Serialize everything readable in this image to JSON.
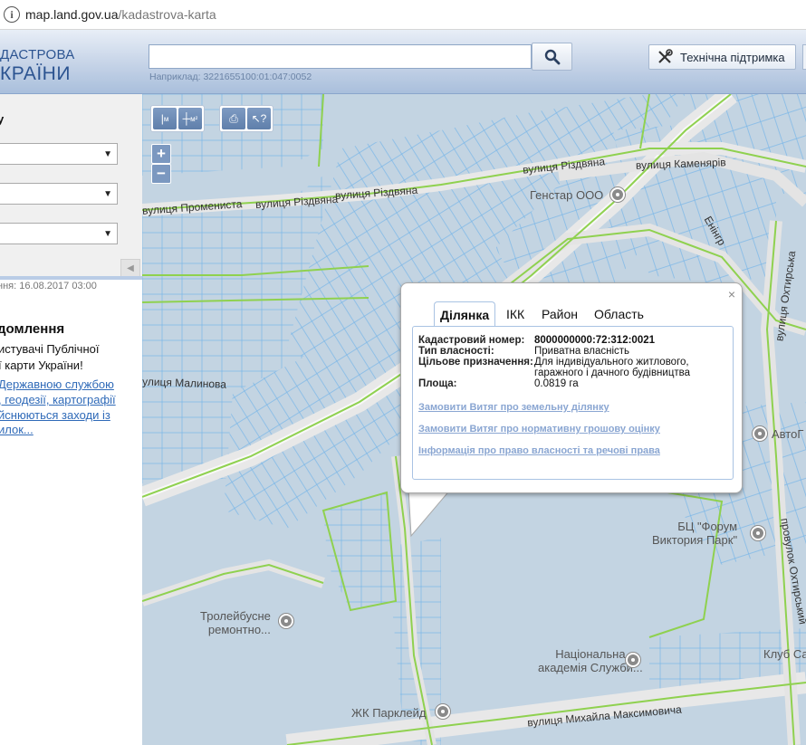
{
  "browser": {
    "url_host": "map.land.gov.ua",
    "url_path": "/kadastrova-karta"
  },
  "header": {
    "logo_line1": "ДАСТРОВА",
    "logo_line2": "КРАЇНИ",
    "search_value": "",
    "search_hint": "Наприклад: 3221655100:01:047:0052",
    "support_label": "Технічна підтримка"
  },
  "sidebar": {
    "title": "у",
    "date": "ння: 16.08.2017 03:00",
    "news_title": "домлення",
    "news_lines": [
      "истувачі Публічної",
      "ї карти України!"
    ],
    "news_link_lines": [
      "Державною службою",
      ", геодезії, картографії",
      "йснюються заходи із",
      "илок..."
    ]
  },
  "map": {
    "tools": {
      "ruler_label": "м",
      "area_label": "м²",
      "zoom_in": "+",
      "zoom_out": "−"
    },
    "streets": [
      "вулиця Промениста",
      "вулиця Різдвяна",
      "вулиця Різдвяна",
      "вулиця Різдвяна",
      "вулиця Каменярів",
      "вулиця Малинова",
      "вулиця Михайла Максимовича",
      "вулиця Охтирська",
      "провулок Охтирський",
      "Енінгр"
    ],
    "pois": [
      "Генстар ООО",
      "АвтоГ",
      "БЦ \"Форум\nВиктория Парк\"",
      "Тролейбусне\nремонтно...",
      "Національна\nакадемія Служби...",
      "ЖК Парклейд",
      "Клуб Са"
    ]
  },
  "popup": {
    "tabs": [
      "Ділянка",
      "ІКК",
      "Район",
      "Область"
    ],
    "active_tab": "Ділянка",
    "fields": [
      {
        "key": "Кадастровий номер:",
        "value": "8000000000:72:312:0021"
      },
      {
        "key": "Тип власності:",
        "value": "Приватна власність"
      },
      {
        "key": "Цільове призначення:",
        "value": "Для індивідуального житлового, гаражного і дачного будівництва"
      },
      {
        "key": "Площа:",
        "value": "0.0819 га"
      }
    ],
    "links": [
      "Замовити Витяг про земельну ділянку",
      "Замовити Витяг про нормативну грошову оцінку",
      "Інформація про право власності та речові права"
    ],
    "close": "×"
  }
}
